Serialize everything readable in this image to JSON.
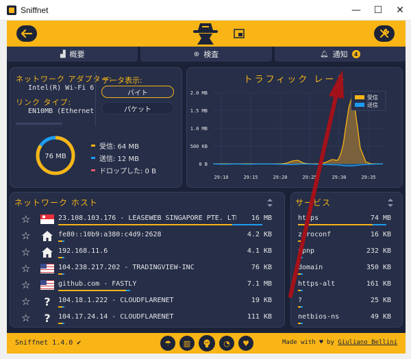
{
  "window": {
    "title": "Sniffnet",
    "controls": [
      "—",
      "☐",
      "✕"
    ]
  },
  "tabs": [
    {
      "icon": "chart-icon",
      "label": "概要"
    },
    {
      "icon": "search-icon",
      "label": "検査"
    },
    {
      "icon": "bell-icon",
      "label": "通知",
      "badge": "4"
    }
  ],
  "overview": {
    "adapter_label": "ネットワーク アダプター:",
    "adapter_value": "Intel(R) Wi-Fi 6 AX201",
    "link_label": "リンク タイプ:",
    "link_value": "EN10MB (Ethernet)",
    "display_label": "データ表示:",
    "display_options": [
      "バイト",
      "パケット"
    ],
    "selected_option": "バイト",
    "total": "76 MB",
    "legend": [
      {
        "label": "受信: 64 MB",
        "color": "#f8b515"
      },
      {
        "label": "送信: 12 MB",
        "color": "#1e9cf0"
      },
      {
        "label": "ドロップした: 0 B",
        "color": "#e85a6a"
      }
    ],
    "donut": {
      "incoming_fraction": 0.842,
      "outgoing_fraction": 0.158
    }
  },
  "traffic": {
    "title": "トラフィック レート",
    "legend": [
      {
        "label": "受信",
        "color": "#f8b515"
      },
      {
        "label": "送信",
        "color": "#1e9cf0"
      }
    ]
  },
  "chart_data": {
    "type": "area",
    "title": "トラフィック レート",
    "xlabel": "",
    "ylabel": "",
    "y_ticks": [
      "2.0 MB",
      "1.5 MB",
      "1.0 MB",
      "500 KB",
      "0 B"
    ],
    "x_ticks": [
      "29:10",
      "29:15",
      "29:20",
      "29:25",
      "29:30",
      "29:35"
    ],
    "ylim": [
      -0.15,
      2.0
    ],
    "xlim": [
      0,
      30
    ],
    "legend_position": "top-right",
    "series": [
      {
        "name": "受信",
        "color": "#f8b515",
        "x": [
          0,
          12,
          13,
          14,
          15,
          15.5,
          16,
          17,
          18,
          19,
          20,
          21,
          22,
          22.5,
          23,
          23.5,
          24,
          24.5,
          25,
          25.5,
          26,
          27,
          28,
          30
        ],
        "values": [
          0,
          0,
          0.02,
          0.08,
          0.1,
          0.06,
          0.02,
          0,
          0,
          0,
          0.05,
          0.12,
          0.1,
          0.25,
          0.55,
          1.1,
          1.6,
          1.85,
          1.6,
          1.05,
          0.45,
          0.05,
          0,
          0
        ]
      },
      {
        "name": "送信",
        "color": "#1e9cf0",
        "x": [
          0,
          2,
          4,
          6,
          8,
          10,
          12,
          14,
          16,
          18,
          20,
          22,
          23,
          24,
          25,
          26,
          28,
          30
        ],
        "values": [
          0,
          -0.01,
          0,
          -0.01,
          0,
          0,
          -0.01,
          -0.02,
          0,
          -0.01,
          -0.02,
          -0.03,
          -0.05,
          -0.06,
          -0.05,
          -0.03,
          -0.01,
          0
        ]
      }
    ]
  },
  "hosts": {
    "title": "ネットワーク ホスト",
    "rows": [
      {
        "icon": "flag-sg-icon",
        "text": "23.108.103.176 - LEASEWEB SINGAPORE PTE. LTD.",
        "size": "16 MB",
        "in_frac": 0.82,
        "out_frac": 0.14
      },
      {
        "icon": "home-icon",
        "text": "fe80::10b9:a380:c4d9:2628",
        "size": "4.2 KB",
        "in_frac": 0.02,
        "out_frac": 0.01
      },
      {
        "icon": "home-icon",
        "text": "192.168.11.6",
        "size": "4.1 KB",
        "in_frac": 0.02,
        "out_frac": 0.01
      },
      {
        "icon": "flag-us-icon",
        "text": "104.238.217.202 - TRADINGVIEW-INC",
        "size": "76 KB",
        "in_frac": 0.02,
        "out_frac": 0.01
      },
      {
        "icon": "flag-us-icon",
        "text": "github.com - FASTLY",
        "size": "7.1 MB",
        "in_frac": 0.32,
        "out_frac": 0.02
      },
      {
        "icon": "unknown-icon",
        "text": "104.18.1.222 - CLOUDFLARENET",
        "size": "19 KB",
        "in_frac": 0.02,
        "out_frac": 0.01
      },
      {
        "icon": "unknown-icon",
        "text": "104.17.24.14 - CLOUDFLARENET",
        "size": "111 KB",
        "in_frac": 0.02,
        "out_frac": 0.01
      }
    ]
  },
  "services": {
    "title": "サービス",
    "rows": [
      {
        "name": "https",
        "size": "74 MB",
        "in_frac": 0.8,
        "out_frac": 0.15
      },
      {
        "name": "zeroconf",
        "size": "16 KB",
        "in_frac": 0.03,
        "out_frac": 0.02
      },
      {
        "name": "upnp",
        "size": "232 KB",
        "in_frac": 0.03,
        "out_frac": 0.02
      },
      {
        "name": "domain",
        "size": "350 KB",
        "in_frac": 0.03,
        "out_frac": 0.02
      },
      {
        "name": "https-alt",
        "size": "161 KB",
        "in_frac": 0.03,
        "out_frac": 0.02
      },
      {
        "name": "?",
        "size": "25 KB",
        "in_frac": 0.03,
        "out_frac": 0.02
      },
      {
        "name": "netbios-ns",
        "size": "49 KB",
        "in_frac": 0.03,
        "out_frac": 0.02
      }
    ]
  },
  "footer": {
    "version": "Sniffnet 1.4.0 ✔",
    "made_with_prefix": "Made with",
    "heart": "♥",
    "by": "by",
    "author": "Giuliano Bellini",
    "links": [
      "wiki-icon",
      "book-icon",
      "github-icon",
      "rss-icon",
      "heart-icon"
    ]
  },
  "colors": {
    "accent": "#f8b515",
    "background": "#1b2238",
    "panel": "#262e48",
    "incoming": "#f8b515",
    "outgoing": "#1e9cf0"
  }
}
